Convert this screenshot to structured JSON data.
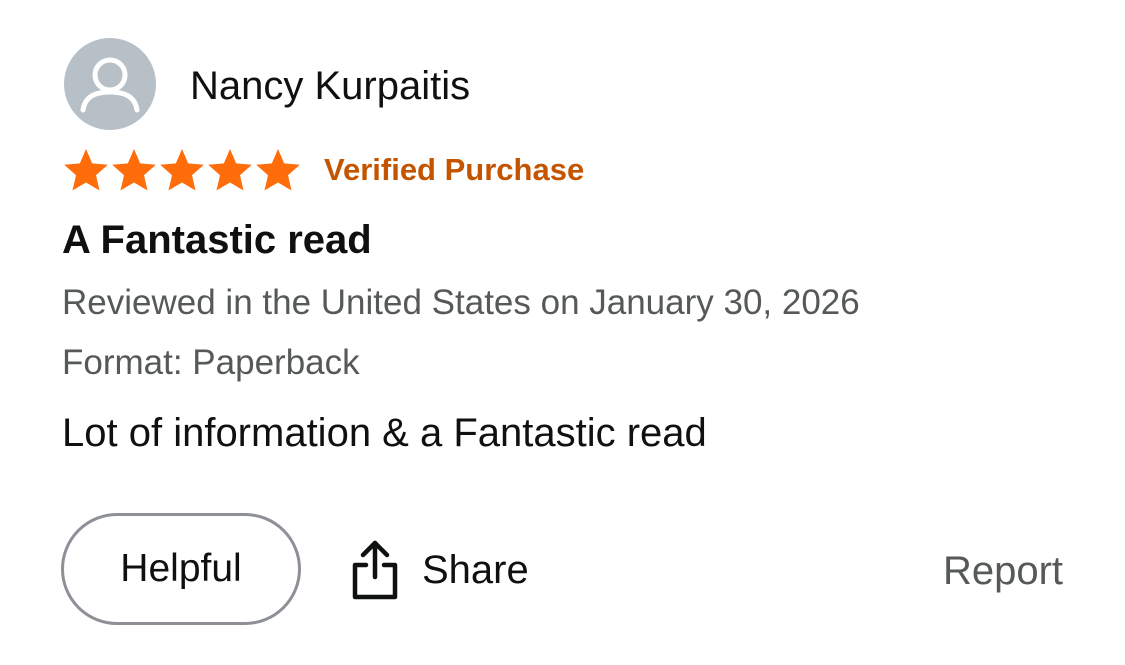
{
  "review": {
    "reviewer": {
      "name": "Nancy Kurpaitis",
      "avatar_icon": "user-silhouette-icon",
      "avatar_color": "#b7c0c6"
    },
    "rating": {
      "stars": 5,
      "max_stars": 5,
      "star_color": "#ff6d0a"
    },
    "verified_label": "Verified Purchase",
    "verified_color": "#c45500",
    "title": "A Fantastic read",
    "meta": "Reviewed in the United States on January 30, 2026",
    "format": "Format: Paperback",
    "body": "Lot of information & a Fantastic read"
  },
  "actions": {
    "helpful_label": "Helpful",
    "share_label": "Share",
    "share_icon": "share-icon",
    "report_label": "Report"
  }
}
